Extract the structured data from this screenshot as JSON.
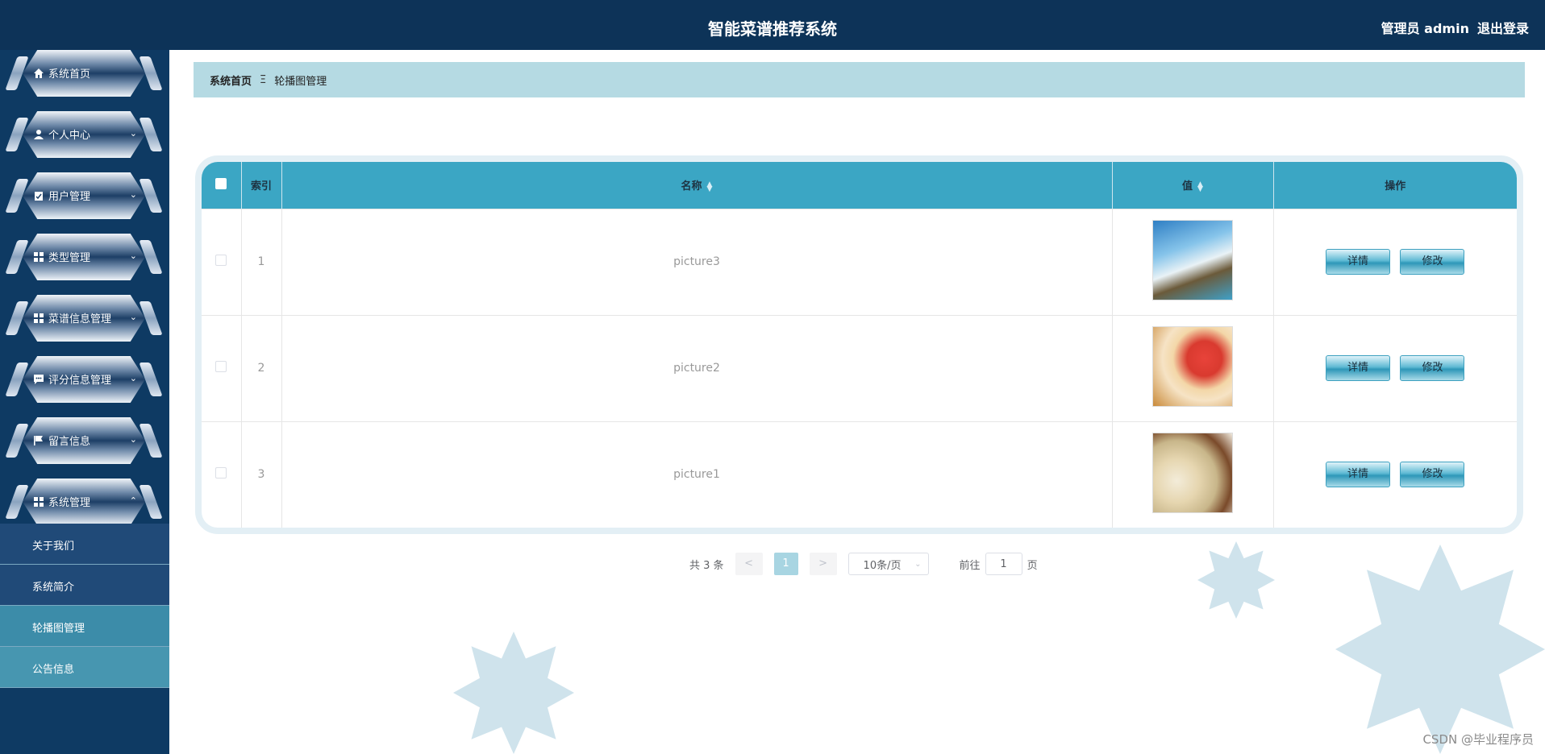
{
  "header": {
    "title": "智能菜谱推荐系统",
    "user": "管理员 admin",
    "logout": "退出登录"
  },
  "sidebar": {
    "items": [
      {
        "label": "系统首页",
        "icon": "home-icon"
      },
      {
        "label": "个人中心",
        "icon": "user-icon"
      },
      {
        "label": "用户管理",
        "icon": "clipboard-icon"
      },
      {
        "label": "类型管理",
        "icon": "grid-icon"
      },
      {
        "label": "菜谱信息管理",
        "icon": "grid-icon"
      },
      {
        "label": "评分信息管理",
        "icon": "chat-icon"
      },
      {
        "label": "留言信息",
        "icon": "flag-icon"
      },
      {
        "label": "系统管理",
        "icon": "grid-icon"
      }
    ],
    "submenu": [
      {
        "label": "关于我们"
      },
      {
        "label": "系统简介"
      },
      {
        "label": "轮播图管理"
      },
      {
        "label": "公告信息"
      }
    ]
  },
  "breadcrumb": {
    "home": "系统首页",
    "separator": "Ξ",
    "current": "轮播图管理"
  },
  "table": {
    "headers": {
      "index": "索引",
      "name": "名称",
      "value": "值",
      "actions": "操作"
    },
    "rows": [
      {
        "index": "1",
        "name": "picture3"
      },
      {
        "index": "2",
        "name": "picture2"
      },
      {
        "index": "3",
        "name": "picture1"
      }
    ],
    "detail_label": "详情",
    "edit_label": "修改"
  },
  "pagination": {
    "total": "共 3 条",
    "prev": "<",
    "page": "1",
    "next": ">",
    "page_size": "10条/页",
    "goto_prefix": "前往",
    "goto_value": "1",
    "goto_suffix": "页"
  },
  "watermark": "CSDN @毕业程序员",
  "colors": {
    "header": "#0d3358",
    "sidebar": "#0e3a63",
    "table_head": "#3ba6c4",
    "breadcrumb": "#b5dae3"
  }
}
